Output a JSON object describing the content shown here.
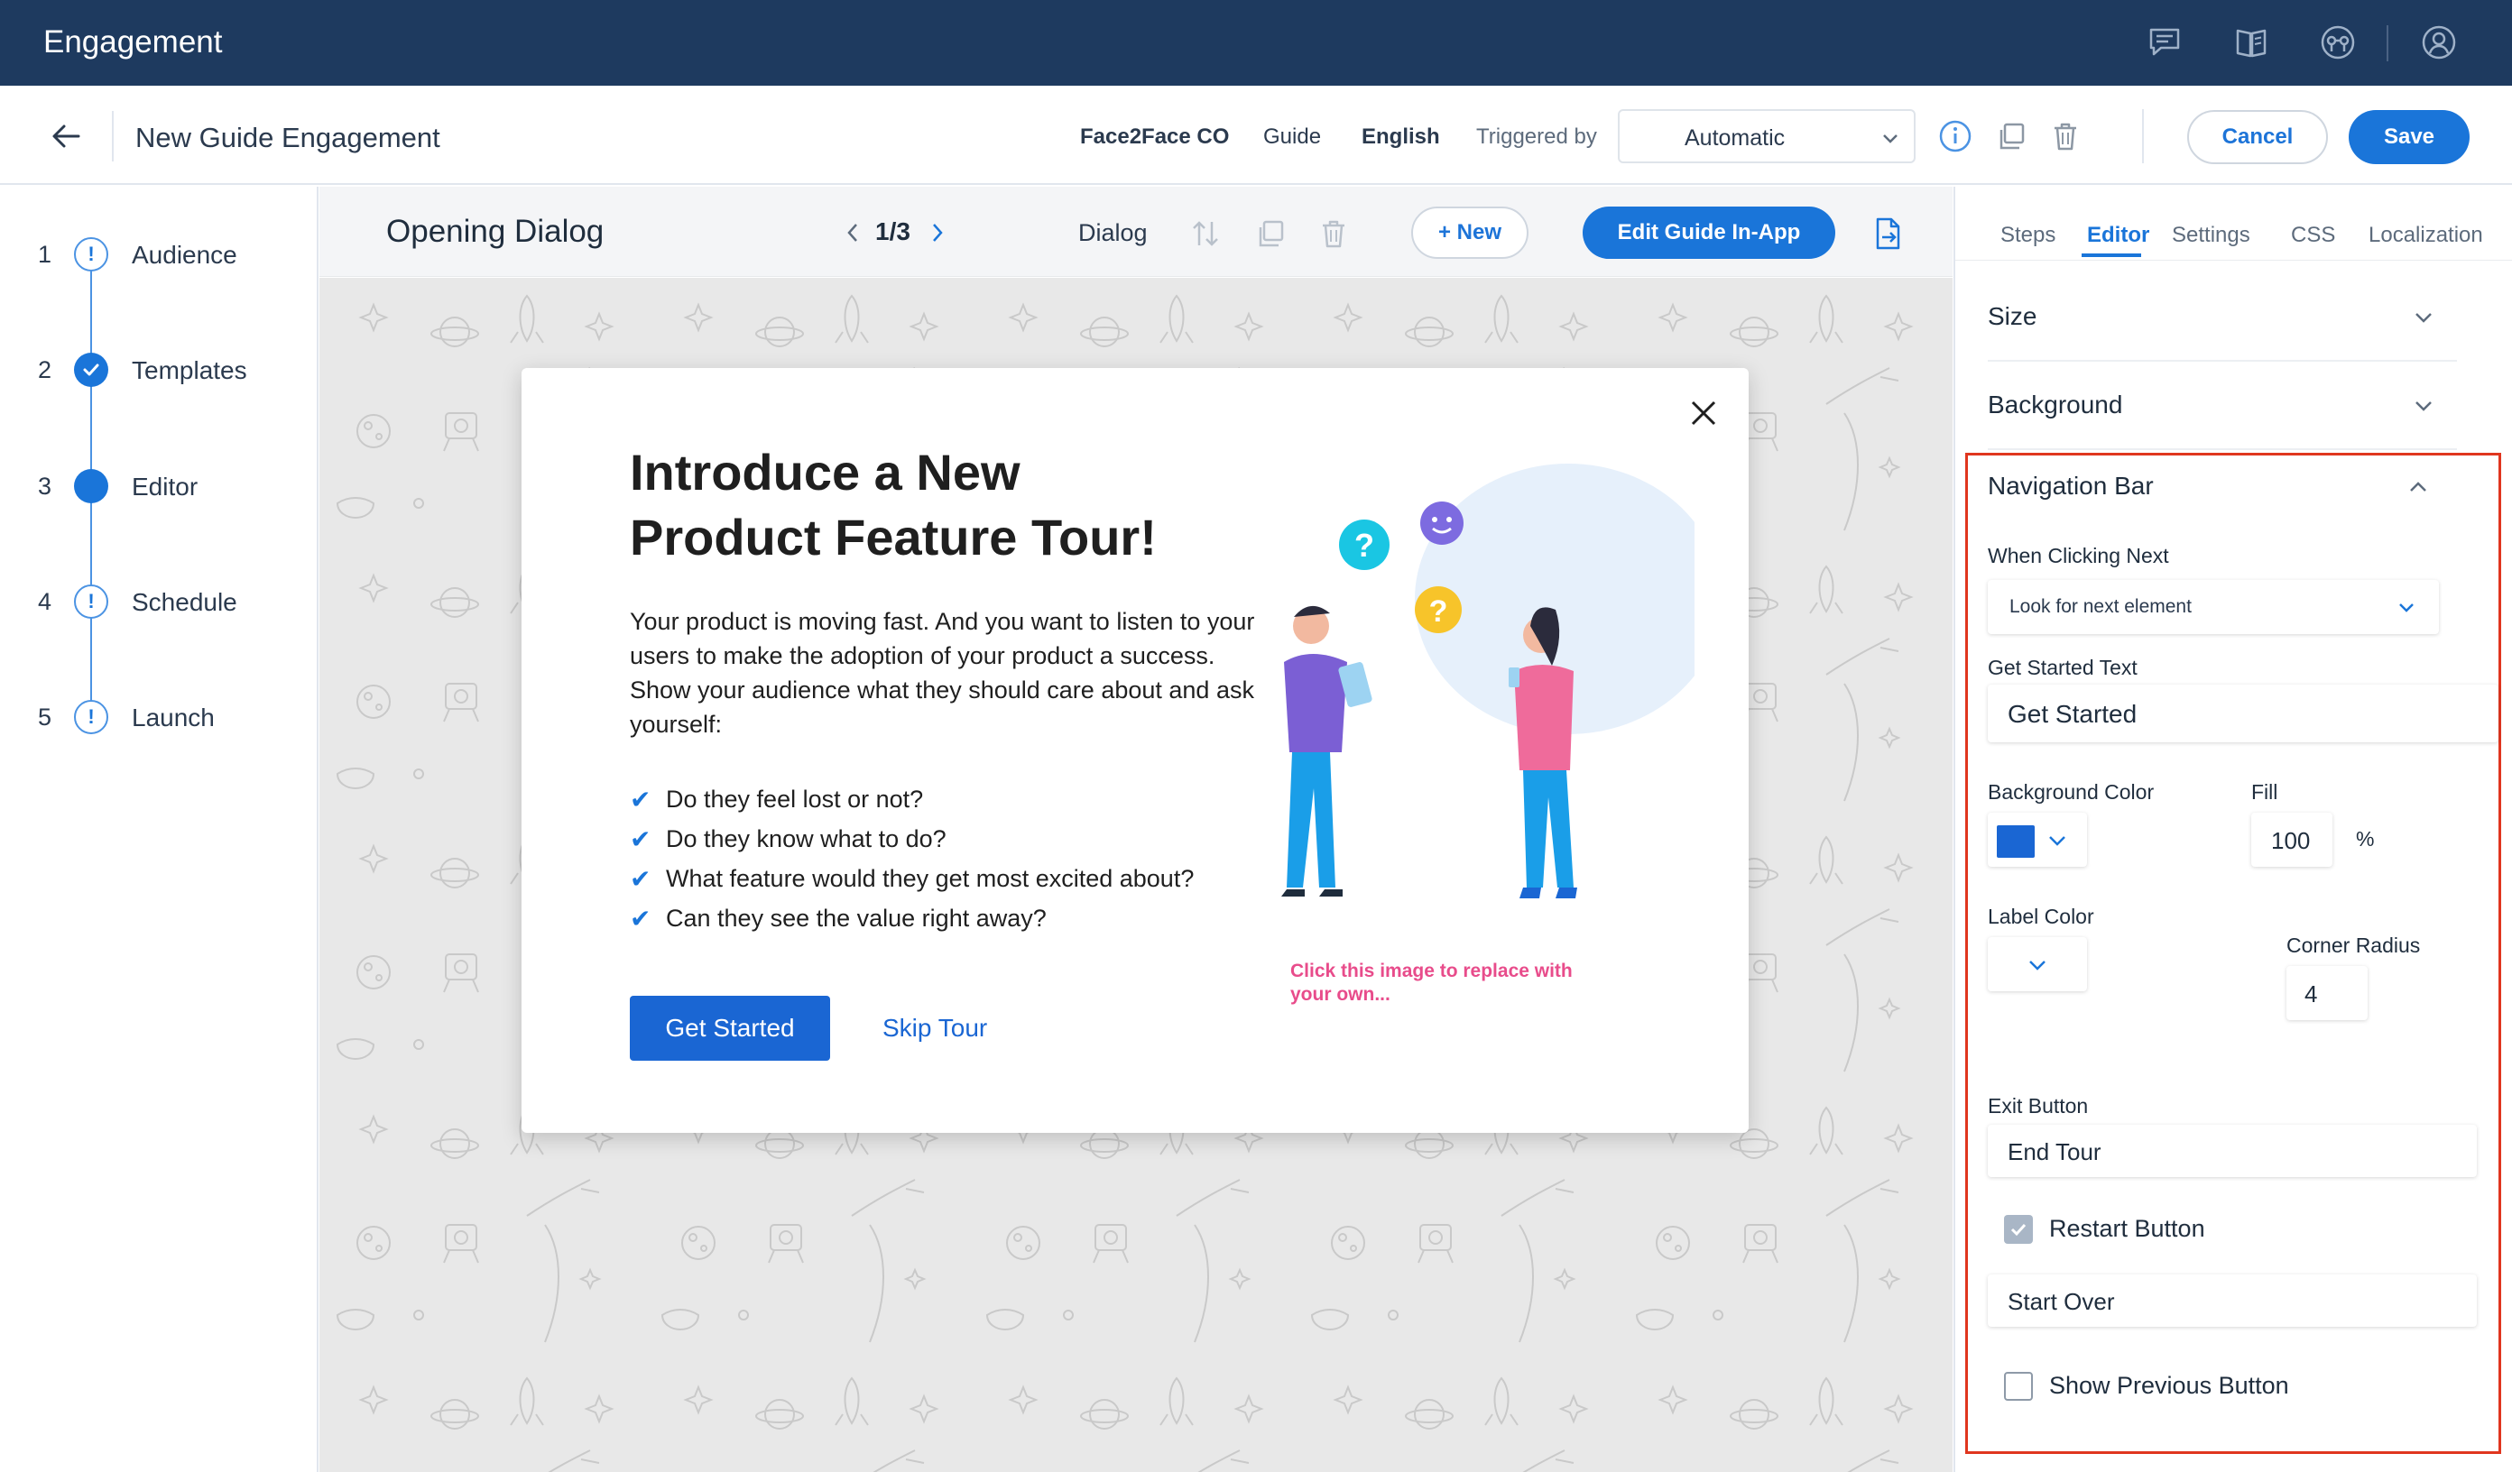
{
  "app": {
    "title": "Engagement"
  },
  "topbar_icons": [
    "chat-icon",
    "book-icon",
    "support-icon",
    "user-icon"
  ],
  "header": {
    "title": "New Guide Engagement",
    "product": "Face2Face CO",
    "type": "Guide",
    "language": "English",
    "triggered_label": "Triggered by",
    "trigger_value": "Automatic",
    "cancel_label": "Cancel",
    "save_label": "Save"
  },
  "steps": [
    {
      "num": "1",
      "label": "Audience",
      "state": "warning"
    },
    {
      "num": "2",
      "label": "Templates",
      "state": "done"
    },
    {
      "num": "3",
      "label": "Editor",
      "state": "current"
    },
    {
      "num": "4",
      "label": "Schedule",
      "state": "warning"
    },
    {
      "num": "5",
      "label": "Launch",
      "state": "warning"
    }
  ],
  "toolbar": {
    "title": "Opening Dialog",
    "pager": "1/3",
    "type": "Dialog",
    "new_label": "+ New",
    "edit_label": "Edit Guide In-App"
  },
  "dialog": {
    "heading": "Introduce a New Product Feature Tour!",
    "body": "Your product is moving fast. And you want to listen to your users to make the adoption of your product a success. Show your audience what they should care about and ask yourself:",
    "checks": [
      "Do they feel lost or not?",
      "Do they know what to do?",
      "What feature would they get most excited about?",
      "Can they see the value right away?"
    ],
    "check_mark": "✔",
    "primary_button": "Get Started",
    "secondary_link": "Skip Tour",
    "image_hint": "Click this image to replace with your own...",
    "illustration_marks": [
      "?",
      "?"
    ]
  },
  "panel": {
    "tabs": [
      "Steps",
      "Editor",
      "Settings",
      "CSS",
      "Localization"
    ],
    "active_tab": "Editor",
    "sections": [
      "Size",
      "Background"
    ],
    "nav_bar": {
      "title": "Navigation Bar",
      "when_clicking_next_label": "When Clicking Next",
      "when_clicking_next_value": "Look for next element",
      "get_started_text_label": "Get Started Text",
      "get_started_text_value": "Get Started",
      "background_color_label": "Background Color",
      "background_color": "#1a66d3",
      "fill_label": "Fill",
      "fill_value": "100",
      "fill_unit": "%",
      "label_color_label": "Label Color",
      "corner_radius_label": "Corner Radius",
      "corner_radius_value": "4",
      "exit_button_label": "Exit Button",
      "exit_button_value": "End Tour",
      "restart_button_label": "Restart Button",
      "restart_button_checked": true,
      "restart_button_value": "Start Over",
      "show_previous_label": "Show Previous Button",
      "show_previous_checked": false
    }
  },
  "colors": {
    "topbar": "#1e3a5f",
    "accent": "#1a75d9",
    "highlight_border": "#e0361f",
    "canvas_bg": "#e8e8e8"
  }
}
